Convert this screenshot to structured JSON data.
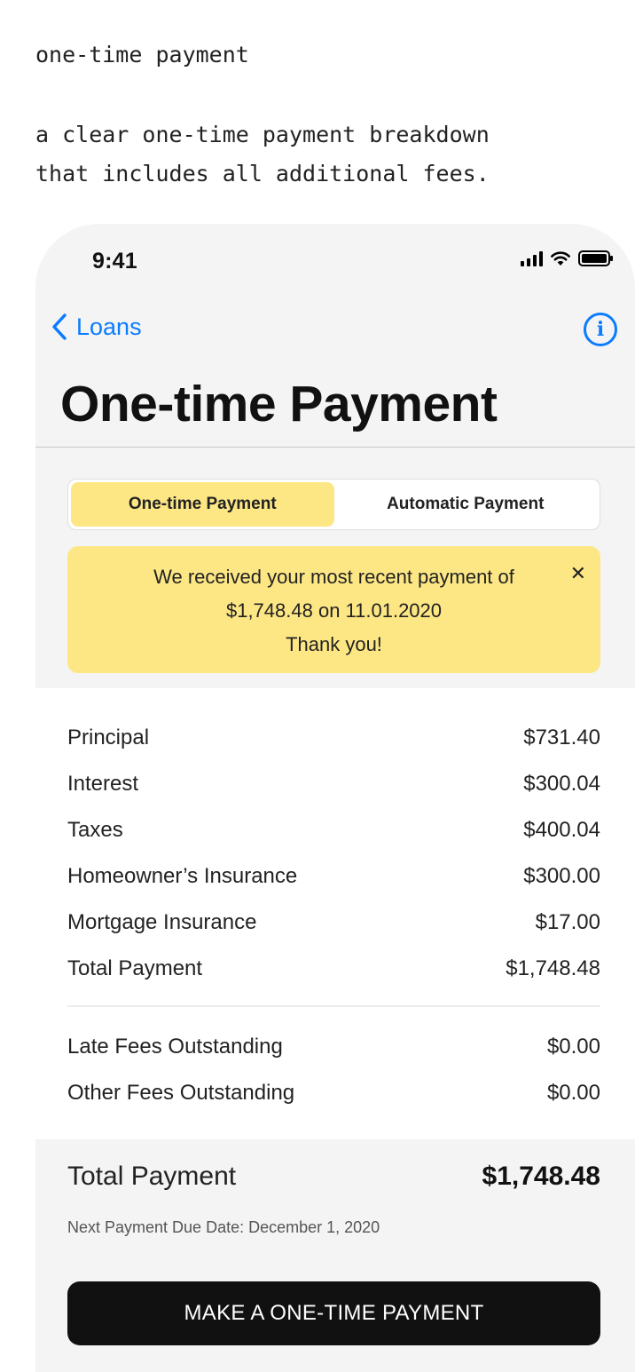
{
  "intro": {
    "heading": "one-time payment",
    "description_line1": "a clear one-time payment breakdown",
    "description_line2": "that includes all additional fees."
  },
  "status_bar": {
    "time": "9:41"
  },
  "nav": {
    "back_label": "Loans",
    "back_icon": "chevron-left-icon",
    "info_icon": "info-icon",
    "info_glyph": "i"
  },
  "title": "One-time Payment",
  "segments": [
    {
      "label": "One-time Payment",
      "active": true
    },
    {
      "label": "Automatic Payment",
      "active": false
    }
  ],
  "banner": {
    "line1": "We received your most recent payment of",
    "line2": "$1,748.48 on 11.01.2020",
    "line3": "Thank you!",
    "close_glyph": "✕"
  },
  "breakdown": [
    {
      "label": "Principal",
      "amount": "$731.40"
    },
    {
      "label": "Interest",
      "amount": "$300.04"
    },
    {
      "label": "Taxes",
      "amount": "$400.04"
    },
    {
      "label": "Homeowner’s Insurance",
      "amount": "$300.00"
    },
    {
      "label": "Mortgage Insurance",
      "amount": "$17.00"
    },
    {
      "label": "Total Payment",
      "amount": "$1,748.48"
    }
  ],
  "fees": [
    {
      "label": "Late Fees Outstanding",
      "amount": "$0.00"
    },
    {
      "label": "Other Fees Outstanding",
      "amount": "$0.00"
    }
  ],
  "summary": {
    "total_label": "Total Payment",
    "total_value": "$1,748.48",
    "due_text": "Next Payment Due Date: December 1, 2020"
  },
  "cta_label": "MAKE A ONE-TIME PAYMENT",
  "colors": {
    "accent_blue": "#0a7cff",
    "highlight_yellow": "#fde785",
    "button_black": "#111111"
  }
}
